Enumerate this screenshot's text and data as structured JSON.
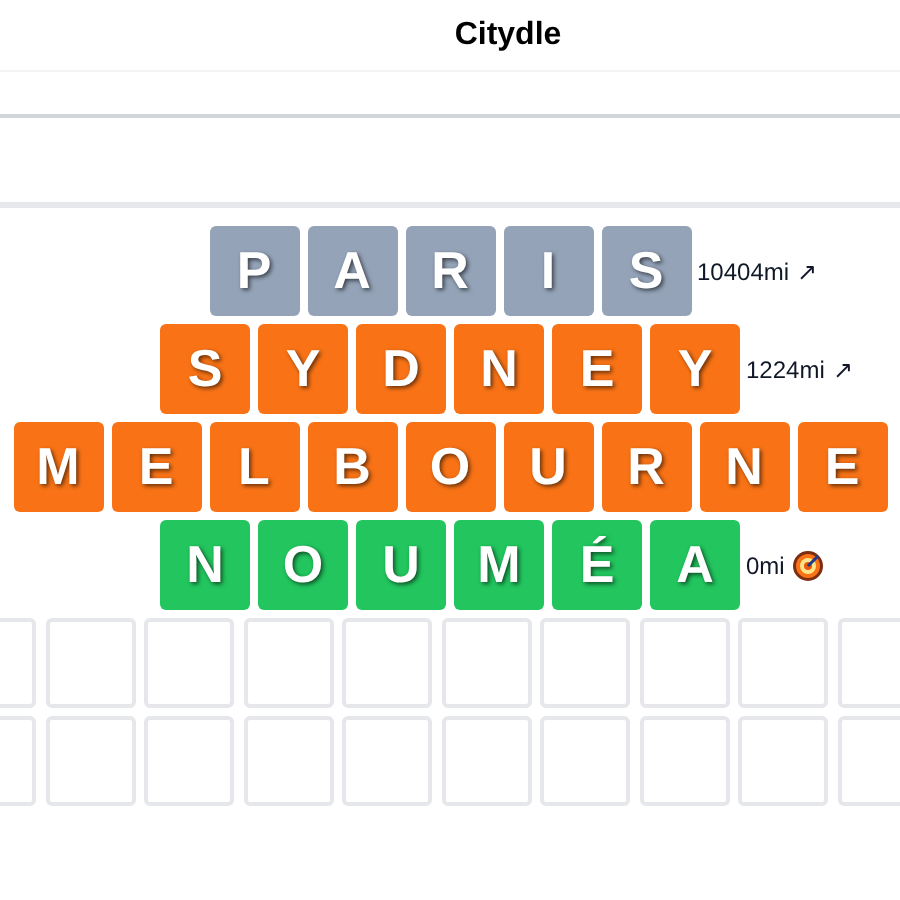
{
  "title": "Citydle",
  "guesses": [
    {
      "letters": [
        "P",
        "A",
        "R",
        "I",
        "S"
      ],
      "color": "#94a3b8",
      "distance": "10404mi",
      "direction": {
        "kind": "arrow",
        "symbol": "↗"
      }
    },
    {
      "letters": [
        "S",
        "Y",
        "D",
        "N",
        "E",
        "Y"
      ],
      "color": "#f97316",
      "distance": "1224mi",
      "direction": {
        "kind": "arrow",
        "symbol": "↗"
      }
    },
    {
      "letters": [
        "M",
        "E",
        "L",
        "B",
        "O",
        "U",
        "R",
        "N",
        "E"
      ],
      "color": "#f97316"
    },
    {
      "letters": [
        "N",
        "O",
        "U",
        "M",
        "É",
        "A"
      ],
      "color": "#22c55e",
      "distance": "0mi",
      "direction": {
        "kind": "target"
      }
    }
  ]
}
